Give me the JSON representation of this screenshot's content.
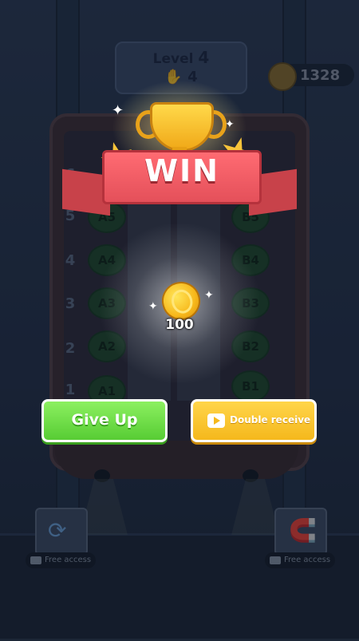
{
  "hud": {
    "level_label": "Level",
    "level_value": "4",
    "moves_value": "4",
    "coins": "1328"
  },
  "board": {
    "row_numbers": [
      "1",
      "2",
      "3",
      "4",
      "5",
      "6"
    ],
    "column_a": [
      "A1",
      "A2",
      "A3",
      "A4",
      "A5"
    ],
    "column_b": [
      "B1",
      "B2",
      "B3",
      "B4",
      "B5"
    ]
  },
  "win_popup": {
    "title": "WIN",
    "reward_amount": "100",
    "give_up_label": "Give Up",
    "double_label": "Double receive"
  },
  "powerups": {
    "left_free_label": "Free access",
    "right_free_label": "Free access"
  },
  "colors": {
    "ribbon": "#e4505a",
    "give_up_button": "#57cc34",
    "double_button": "#f5b81c",
    "coin": "#f7b81b"
  }
}
